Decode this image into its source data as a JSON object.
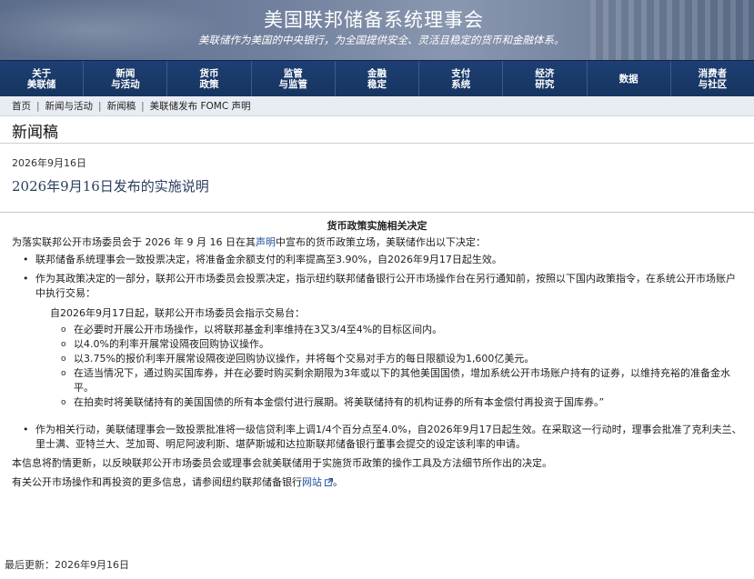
{
  "banner": {
    "title": "美国联邦储备系统理事会",
    "tagline": "美联储作为美国的中央银行，为全国提供安全、灵活且稳定的货币和金融体系。"
  },
  "nav": [
    {
      "label": "关于\n美联储"
    },
    {
      "label": "新闻\n与活动"
    },
    {
      "label": "货币\n政策"
    },
    {
      "label": "监管\n与监管"
    },
    {
      "label": "金融\n稳定"
    },
    {
      "label": "支付\n系统"
    },
    {
      "label": "经济\n研究"
    },
    {
      "label": "数据"
    },
    {
      "label": "消费者\n与社区"
    }
  ],
  "breadcrumb": [
    "首页",
    "新闻与活动",
    "新闻稿",
    "美联储发布 FOMC 声明"
  ],
  "section_title": "新闻稿",
  "date": "2026年9月16日",
  "doc_title": "2026年9月16日发布的实施说明",
  "body": {
    "heading": "货币政策实施相关决定",
    "intro_before": "为落实联邦公开市场委员会于 2026 年 9 月 16 日在其",
    "intro_link": "声明",
    "intro_after": "中宣布的货币政策立场，美联储作出以下决定：",
    "bullet1": "联邦储备系统理事会一致投票决定，将准备金余额支付的利率提高至3.90%，自2026年9月17日起生效。",
    "bullet2": "作为其政策决定的一部分，联邦公开市场委员会投票决定，指示纽约联邦储备银行公开市场操作台在另行通知前，按照以下国内政策指令，在系统公开市场账户中执行交易：",
    "directive_intro": "自2026年9月17日起，联邦公开市场委员会指示交易台：",
    "sub": [
      "在必要时开展公开市场操作，以将联邦基金利率维持在3又3/4至4%的目标区间内。",
      "以4.0%的利率开展常设隔夜回购协议操作。",
      "以3.75%的报价利率开展常设隔夜逆回购协议操作，并将每个交易对手方的每日限额设为1,600亿美元。",
      "在适当情况下，通过购买国库券，并在必要时购买剩余期限为3年或以下的其他美国国债，增加系统公开市场账户持有的证券，以维持充裕的准备金水平。",
      "在拍卖时将美联储持有的美国国债的所有本金偿付进行展期。将美联储持有的机构证券的所有本金偿付再投资于国库券。”"
    ],
    "bullet3": "作为相关行动，美联储理事会一致投票批准将一级信贷利率上调1/4个百分点至4.0%，自2026年9月17日起生效。在采取这一行动时，理事会批准了克利夫兰、里士满、亚特兰大、芝加哥、明尼阿波利斯、堪萨斯城和达拉斯联邦储备银行董事会提交的设定该利率的申请。",
    "para_update": "本信息将酌情更新，以反映联邦公开市场委员会或理事会就美联储用于实施货币政策的操作工具及方法细节所作出的决定。",
    "para_more_before": "有关公开市场操作和再投资的更多信息，请参阅纽约联邦储备银行",
    "para_more_link": "网站",
    "para_more_after": "。"
  },
  "footer": "最后更新：2026年9月16日"
}
